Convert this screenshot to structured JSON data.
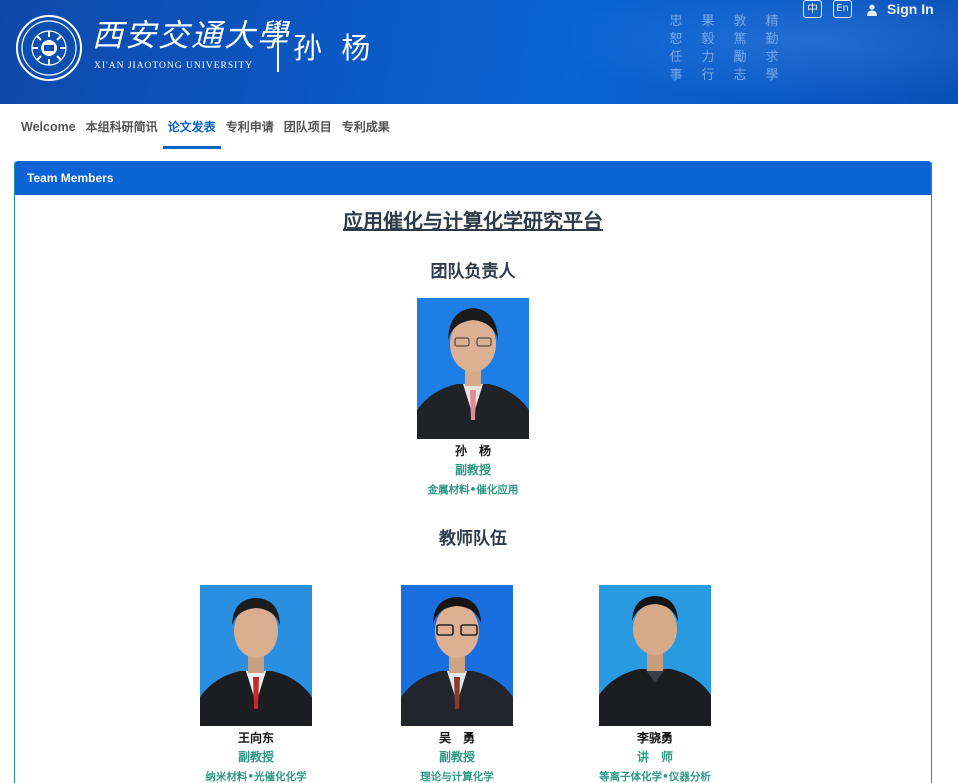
{
  "header": {
    "university_cn": "西安交通大學",
    "university_en": "XI'AN JIAOTONG UNIVERSITY",
    "person_name": "孙 杨",
    "motto_chars": [
      "忠",
      "果",
      "敦",
      "精",
      "恕",
      "毅",
      "篤",
      "勤",
      "任",
      "力",
      "勵",
      "求",
      "事",
      "行",
      "志",
      "學"
    ],
    "lang_zh": "中",
    "lang_en": "En",
    "signin_label": "Sign In"
  },
  "nav": {
    "items": [
      "Welcome",
      "本组科研简讯",
      "论文发表",
      "专利申请",
      "团队项目",
      "专利成果"
    ],
    "active_index": 2
  },
  "panel": {
    "header": "Team Members",
    "platform_title": "应用催化与计算化学研究平台",
    "leader_section": "团队负责人",
    "leader": {
      "name": "孙　杨",
      "title": "副教授",
      "field": "金属材料•催化应用"
    },
    "teachers_section": "教师队伍",
    "teachers": [
      {
        "name": "王向东",
        "title": "副教授",
        "field": "纳米材料•光催化化学"
      },
      {
        "name": "吴　勇",
        "title": "副教授",
        "field": "理论与计算化学"
      },
      {
        "name": "李骁勇",
        "title": "讲　师",
        "field": "等离子体化学•仪器分析"
      }
    ]
  },
  "colors": {
    "header_blue": "#0b58c4",
    "accent_blue": "#0b62c8",
    "teal_text": "#2f9a85",
    "panel_border": "#1f8f9f"
  }
}
